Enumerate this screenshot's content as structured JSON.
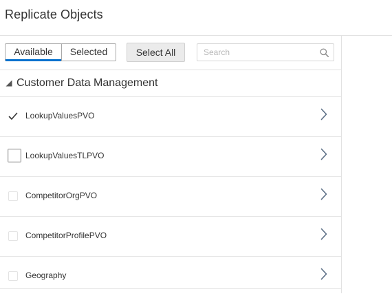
{
  "header": {
    "title": "Replicate Objects"
  },
  "toolbar": {
    "tabs": [
      {
        "label": "Available",
        "active": true
      },
      {
        "label": "Selected",
        "active": false
      }
    ],
    "select_all_label": "Select All",
    "search_placeholder": "Search",
    "search_value": ""
  },
  "group": {
    "label": "Customer Data Management",
    "expanded": true
  },
  "rows": [
    {
      "label": "LookupValuesPVO",
      "checked": true
    },
    {
      "label": "LookupValuesTLPVO",
      "checked": false,
      "focused": true
    },
    {
      "label": "CompetitorOrgPVO",
      "checked": false
    },
    {
      "label": "CompetitorProfilePVO",
      "checked": false
    },
    {
      "label": "Geography",
      "checked": false
    }
  ],
  "colors": {
    "accent": "#0572ce",
    "text": "#333333",
    "chevron": "#5b6e85"
  },
  "icons": [
    "search-icon",
    "collapse-triangle-icon",
    "checkmark-icon",
    "chevron-right-icon"
  ]
}
